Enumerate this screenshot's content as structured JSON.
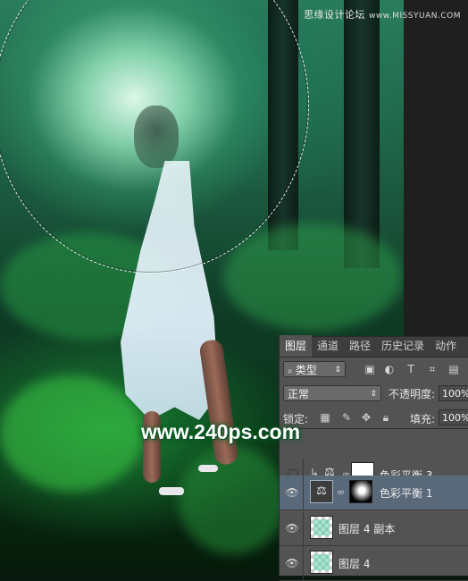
{
  "watermark_top": {
    "site": "思缘设计论坛",
    "url": "www.MISSYUAN.COM"
  },
  "watermark_big": "www.240ps.com",
  "panel": {
    "tabs": [
      {
        "label": "图层",
        "active": true
      },
      {
        "label": "通道",
        "active": false
      },
      {
        "label": "路径",
        "active": false
      },
      {
        "label": "历史记录",
        "active": false
      },
      {
        "label": "动作",
        "active": false
      }
    ],
    "filter_label": "类型",
    "blend_mode": "正常",
    "opacity_label": "不透明度:",
    "opacity_value": "100%",
    "lock_label": "锁定:",
    "fill_label": "填充:",
    "fill_value": "100%",
    "layers": [
      {
        "name": "色彩平衡 3",
        "visible": false,
        "clipped": true
      },
      {
        "name": "色彩平衡 1",
        "visible": true,
        "selected": true
      },
      {
        "name": "图层 4 副本",
        "visible": true
      },
      {
        "name": "图层 4",
        "visible": true
      }
    ]
  },
  "colors": {
    "panel_bg": "#535353",
    "selected_layer": "#59697a",
    "canvas_green": "#1d5e43"
  },
  "icons": [
    "eye-icon",
    "balance-icon",
    "chain-icon",
    "search-icon",
    "lock-icon",
    "move-icon",
    "brush-icon",
    "dropdown-arrow-icon"
  ]
}
